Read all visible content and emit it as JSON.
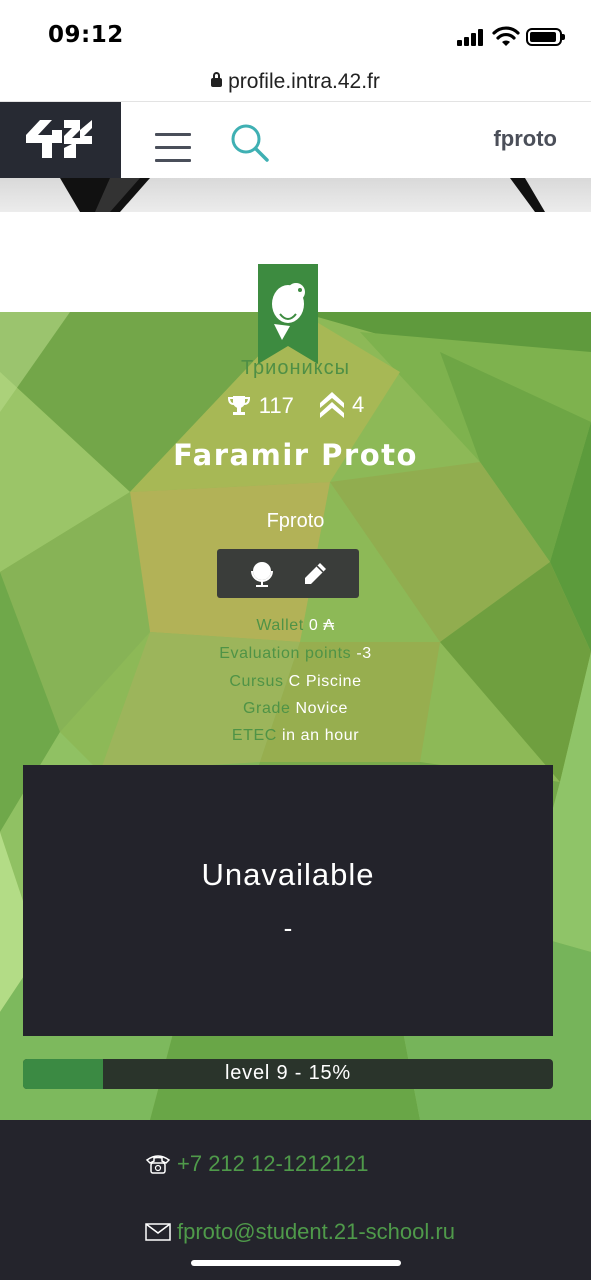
{
  "status_bar": {
    "time": "09:12"
  },
  "browser": {
    "url": "profile.intra.42.fr"
  },
  "header": {
    "logo_text": "42",
    "username": "fproto"
  },
  "coalition": {
    "name": "Триониксы"
  },
  "stats": {
    "trophies": "117",
    "level_chevrons": "4"
  },
  "profile": {
    "full_name": "Faramir Proto",
    "login": "Fproto",
    "info": [
      {
        "key": "Wallet",
        "value": "0 ₳"
      },
      {
        "key": "Evaluation points",
        "value": "-3"
      },
      {
        "key": "Cursus",
        "value": "C Piscine"
      },
      {
        "key": "Grade",
        "value": "Novice"
      },
      {
        "key": "ETEC",
        "value": "in an hour"
      }
    ]
  },
  "location": {
    "title": "Unavailable",
    "subtitle": "-"
  },
  "level": {
    "label": "level 9 - 15%",
    "progress": 0.15
  },
  "footer": {
    "phone": "+7 212 12-1212121",
    "email": "fproto@student.21-school.ru"
  },
  "colors": {
    "accent_green": "#4f9a4a",
    "dark": "#24242c"
  },
  "icons": [
    "lock-icon",
    "menu-icon",
    "search-icon",
    "trophy-icon",
    "chevrons-up-icon",
    "globe-icon",
    "pencil-icon",
    "phone-icon",
    "envelope-icon"
  ]
}
